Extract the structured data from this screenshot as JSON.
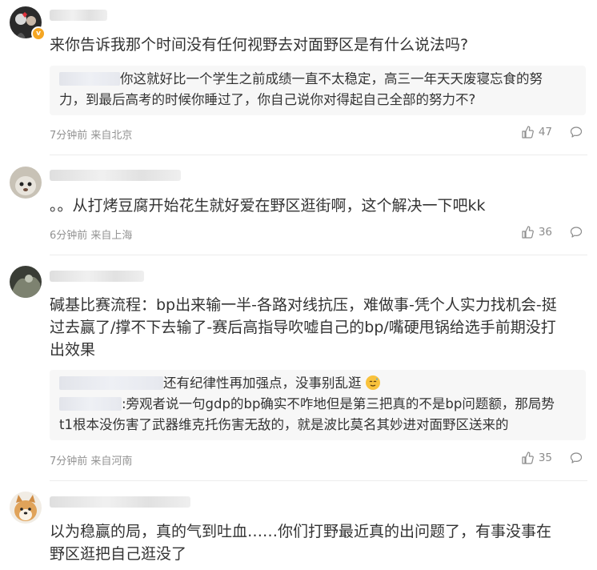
{
  "comments": [
    {
      "text": "来你告诉我那个时间没有任何视野去对面野区是有什么说法吗?",
      "replies": [
        {
          "lines": [
            "你这就好比一个学生之前成绩一直不太稳定，高三一年天天废寝忘食的努",
            "力，到最后高考的时候你睡过了，你自己说你对得起自己全部的努力不?"
          ]
        }
      ],
      "time": "7分钟前",
      "location": "来自北京",
      "likes": "47",
      "verified_badge": "v"
    },
    {
      "text": "。。从打烤豆腐开始花生就好爱在野区逛街啊，这个解决一下吧kk",
      "time": "6分钟前",
      "location": "来自上海",
      "likes": "36"
    },
    {
      "text_lines": [
        "碱基比赛流程：bp出来输一半-各路对线抗压，难做事-凭个人实力找机会-挺",
        "过去赢了/撑不下去输了-赛后高指导吹嘘自己的bp/嘴硬甩锅给选手前期没打",
        "出效果"
      ],
      "replies": [
        {
          "lines": [
            "还有纪律性再加强点，没事别乱逛"
          ]
        },
        {
          "lines": [
            ":旁观者说一句gdp的bp确实不咋地但是第三把真的不是bp问题额，那局势",
            "t1根本没伤害了武器维克托伤害无敌的，就是波比莫名其妙进对面野区送来的"
          ]
        }
      ],
      "time": "7分钟前",
      "location": "来自河南",
      "likes": "35"
    },
    {
      "text_lines": [
        "以为稳赢的局，真的气到吐血……你们打野最近真的出问题了，有事没事在",
        "野区逛把自己逛没了"
      ]
    }
  ],
  "colors": {
    "text": "#333333",
    "meta": "#939393",
    "reply_bg": "#f7f7f7",
    "badge": "#f5a623"
  },
  "icons": {
    "like": "thumbs-up-icon",
    "comment": "speech-bubble-icon",
    "emoji": "sweat-smile-emoji-icon"
  }
}
